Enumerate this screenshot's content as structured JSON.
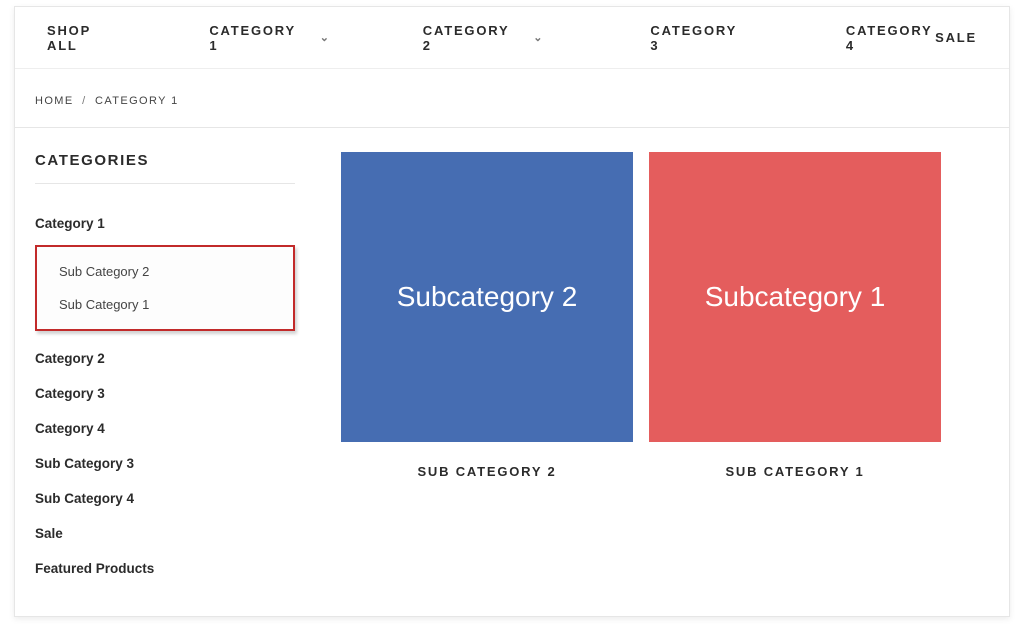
{
  "nav": {
    "items": [
      {
        "label": "SHOP ALL",
        "dropdown": false
      },
      {
        "label": "CATEGORY 1",
        "dropdown": true
      },
      {
        "label": "CATEGORY 2",
        "dropdown": true
      },
      {
        "label": "CATEGORY 3",
        "dropdown": false
      },
      {
        "label": "CATEGORY 4",
        "dropdown": false
      },
      {
        "label": "SALE",
        "dropdown": false
      }
    ]
  },
  "breadcrumb": {
    "home": "HOME",
    "sep": "/",
    "current": "CATEGORY 1"
  },
  "sidebar": {
    "title": "CATEGORIES",
    "items": [
      {
        "label": "Category 1",
        "active": true
      },
      {
        "label": "Category 2"
      },
      {
        "label": "Category 3"
      },
      {
        "label": "Category 4"
      },
      {
        "label": "Sub Category 3"
      },
      {
        "label": "Sub Category 4"
      },
      {
        "label": "Sale"
      },
      {
        "label": "Featured Products"
      }
    ],
    "highlighted_sub": [
      "Sub Category 2",
      "Sub Category 1"
    ]
  },
  "main": {
    "cards": [
      {
        "tile_text": "Subcategory 2",
        "caption": "SUB CATEGORY 2",
        "color": "blue"
      },
      {
        "tile_text": "Subcategory 1",
        "caption": "SUB CATEGORY 1",
        "color": "red"
      }
    ]
  }
}
